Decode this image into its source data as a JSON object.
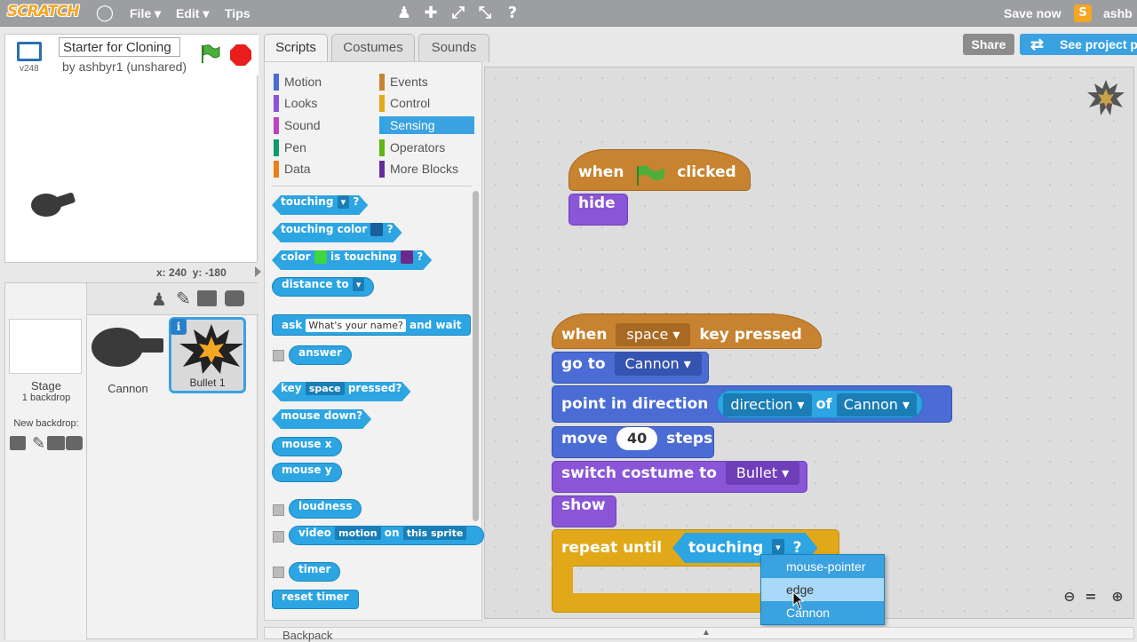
{
  "topbar": {
    "logo": "SCRATCH",
    "file": "File ▾",
    "edit": "Edit ▾",
    "tips": "Tips",
    "save": "Save now",
    "user": "ashb"
  },
  "stage": {
    "title": "Starter for Cloning I",
    "byline": "by ashbyr1 (unshared)",
    "version": "v248",
    "x_label": "x:",
    "x": "240",
    "y_label": "y:",
    "y": "-180"
  },
  "sprites": {
    "stage_label": "Stage",
    "backdrops": "1 backdrop",
    "new_backdrop": "New backdrop:",
    "items": [
      "Cannon",
      "Bullet 1"
    ]
  },
  "tabs": [
    "Scripts",
    "Costumes",
    "Sounds"
  ],
  "share": {
    "share": "Share",
    "see_project": "See project p"
  },
  "categories": {
    "left": [
      "Motion",
      "Looks",
      "Sound",
      "Pen",
      "Data"
    ],
    "right": [
      "Events",
      "Control",
      "Sensing",
      "Operators",
      "More Blocks"
    ],
    "selected": "Sensing"
  },
  "colors": {
    "motion": "#4a6cd4",
    "looks": "#8a55d7",
    "sound": "#bb42c3",
    "pen": "#0e9a6c",
    "data": "#ee7d16",
    "events": "#c88330",
    "control": "#e1a91a",
    "sensing": "#2ca5e2",
    "operators": "#5cb712",
    "more": "#632d99"
  },
  "palette": {
    "touching": "touching",
    "q": "?",
    "touching_color": "touching color",
    "color": "color",
    "is_touching": "is touching",
    "distance_to": "distance to",
    "ask": "ask",
    "ask_value": "What's your name?",
    "and_wait": "and wait",
    "answer": "answer",
    "key": "key",
    "key_value": "space",
    "pressed": "pressed?",
    "mouse_down": "mouse down?",
    "mouse_x": "mouse x",
    "mouse_y": "mouse y",
    "loudness": "loudness",
    "video": "video",
    "video_value": "motion",
    "on": "on",
    "video_target": "this sprite",
    "timer": "timer",
    "reset_timer": "reset timer"
  },
  "script1": {
    "when": "when",
    "clicked": "clicked",
    "hide": "hide"
  },
  "script2": {
    "when": "when",
    "key": "space",
    "key_pressed": "key pressed",
    "go_to": "go to",
    "go_target": "Cannon",
    "point": "point in direction",
    "direction": "direction",
    "of": "of",
    "of_target": "Cannon",
    "move": "move",
    "steps_value": "40",
    "steps": "steps",
    "switch": "switch costume to",
    "costume": "Bullet",
    "show": "show",
    "repeat_until": "repeat until",
    "touching": "touching",
    "q": "?"
  },
  "dropdown": [
    "mouse-pointer",
    "edge",
    "Cannon"
  ],
  "backpack": "Backpack"
}
